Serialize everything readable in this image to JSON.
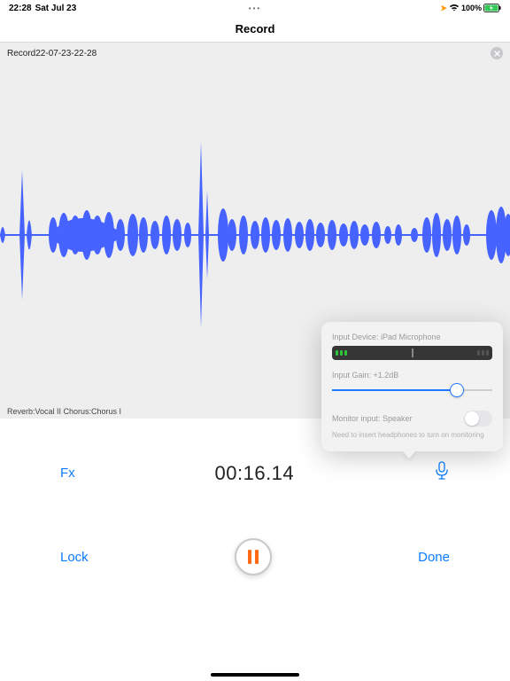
{
  "status": {
    "time": "22:28",
    "date": "Sat Jul 23",
    "center": "•••",
    "battery": "100%"
  },
  "nav": {
    "title": "Record"
  },
  "file": {
    "name": "Record22-07-23-22-28"
  },
  "effects": {
    "label": "Reverb:Vocal II  Chorus:Chorus I"
  },
  "popover": {
    "input_device_label": "Input Device: iPad Microphone",
    "input_gain_label": "Input Gain: +1.2dB",
    "monitor_label": "Monitor input: Speaker",
    "monitor_hint": "Need to insert headphones to turn on monitoring"
  },
  "controls": {
    "fx": "Fx",
    "timer": "00:16.14",
    "lock": "Lock",
    "done": "Done"
  }
}
